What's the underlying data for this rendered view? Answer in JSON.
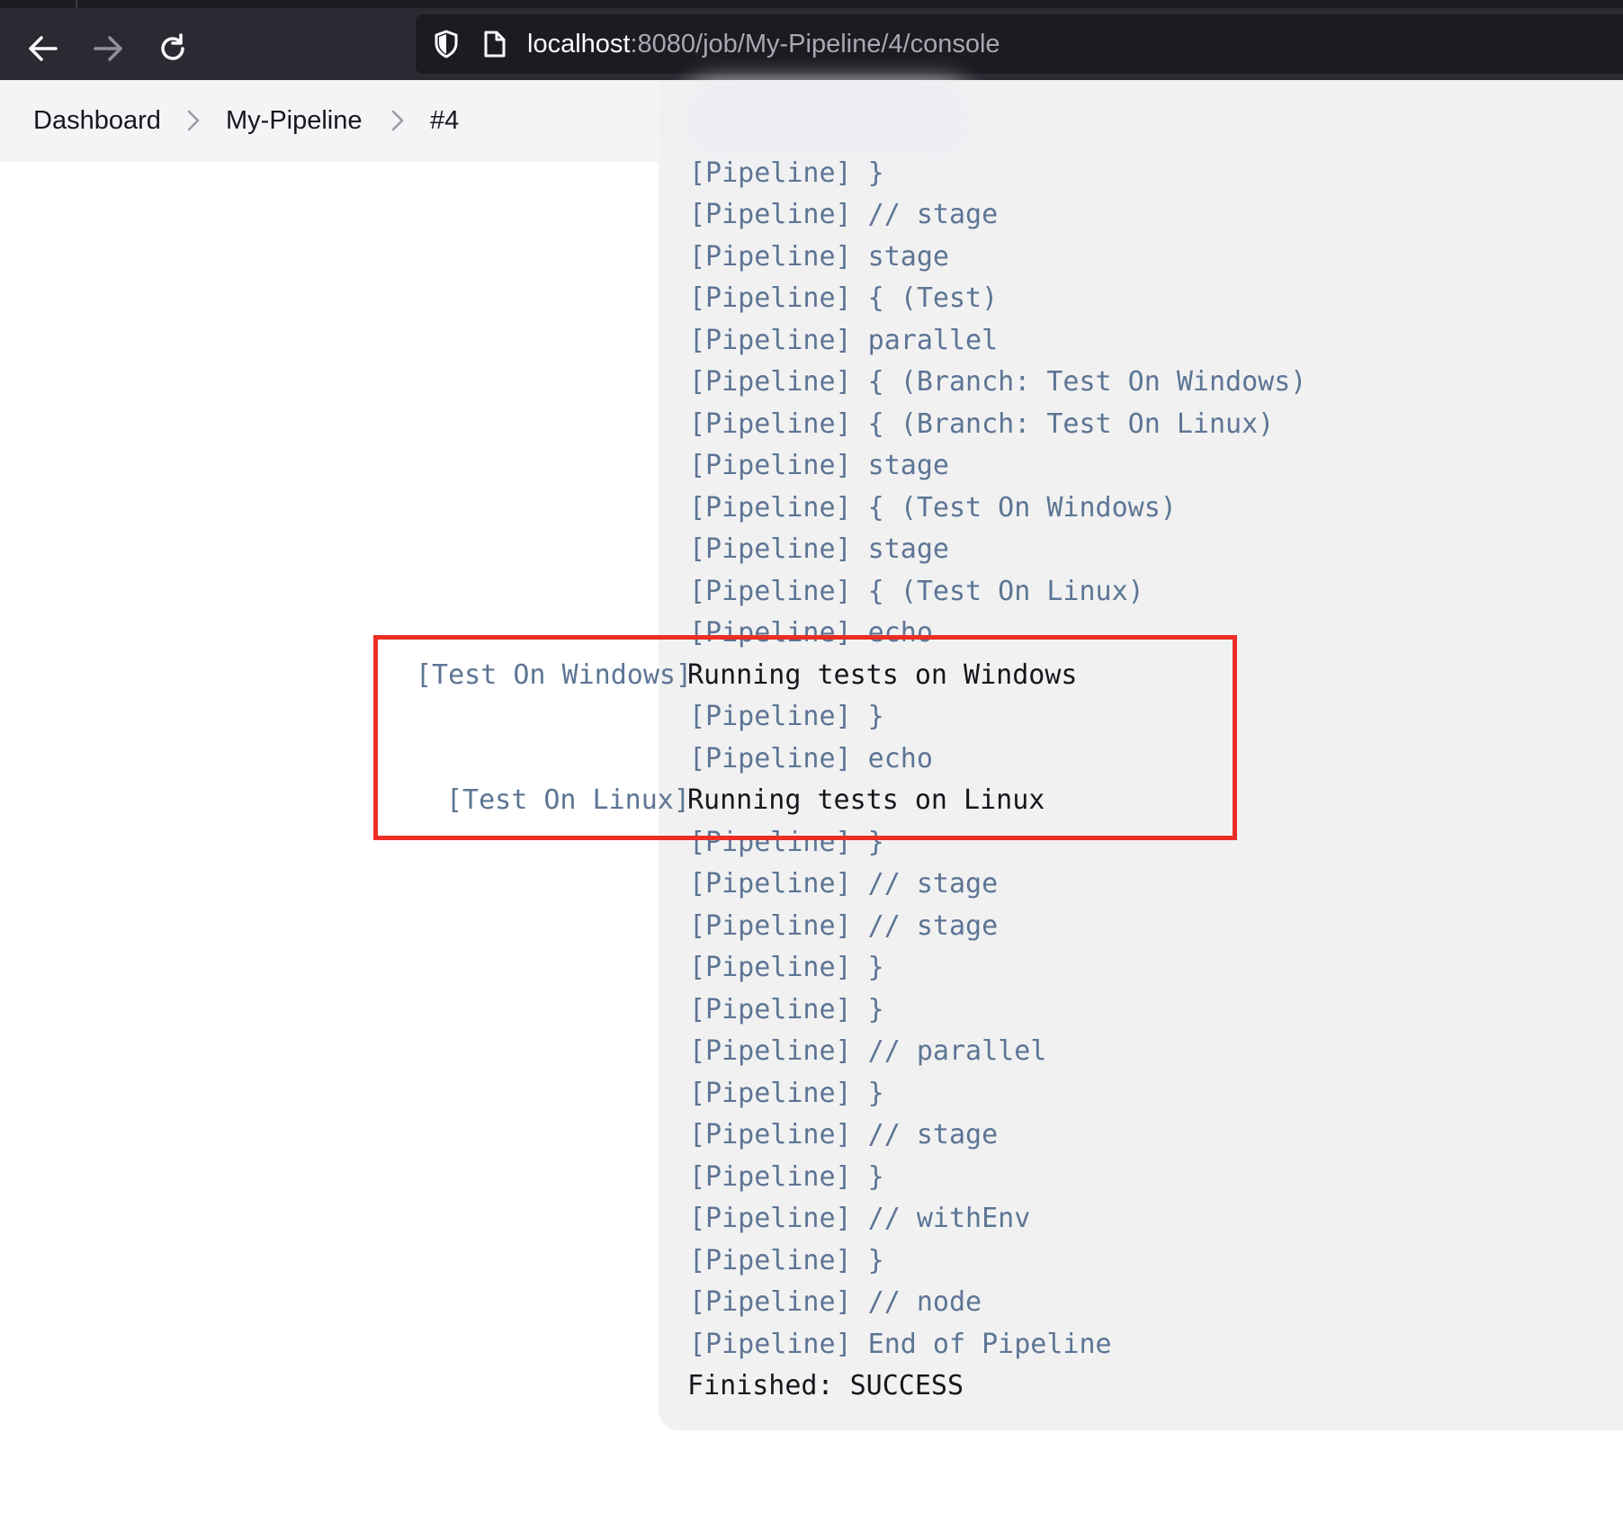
{
  "browser": {
    "url_host": "localhost",
    "url_path": ":8080/job/My-Pipeline/4/console"
  },
  "breadcrumbs": [
    "Dashboard",
    "My-Pipeline",
    "#4"
  ],
  "console": {
    "lines_before": [
      "[Pipeline] }",
      "[Pipeline] // stage",
      "[Pipeline] stage",
      "[Pipeline] { (Test)",
      "[Pipeline] parallel",
      "[Pipeline] { (Branch: Test On Windows)",
      "[Pipeline] { (Branch: Test On Linux)",
      "[Pipeline] stage",
      "[Pipeline] { (Test On Windows)",
      "[Pipeline] stage",
      "[Pipeline] { (Test On Linux)",
      "[Pipeline] echo"
    ],
    "windows_prefix": "[Test On Windows]",
    "windows_message": "Running tests on Windows",
    "lines_middle": [
      "[Pipeline] }",
      "[Pipeline] echo"
    ],
    "linux_prefix": "[Test On Linux]",
    "linux_message": "Running tests on Linux",
    "lines_after": [
      "[Pipeline] }",
      "[Pipeline] // stage",
      "[Pipeline] // stage",
      "[Pipeline] }",
      "[Pipeline] }",
      "[Pipeline] // parallel",
      "[Pipeline] }",
      "[Pipeline] // stage",
      "[Pipeline] }",
      "[Pipeline] // withEnv",
      "[Pipeline] }",
      "[Pipeline] // node",
      "[Pipeline] End of Pipeline"
    ],
    "finished": "Finished: SUCCESS"
  },
  "colors": {
    "highlight": "#ee2e24",
    "pipeline_text": "#5d7594"
  }
}
